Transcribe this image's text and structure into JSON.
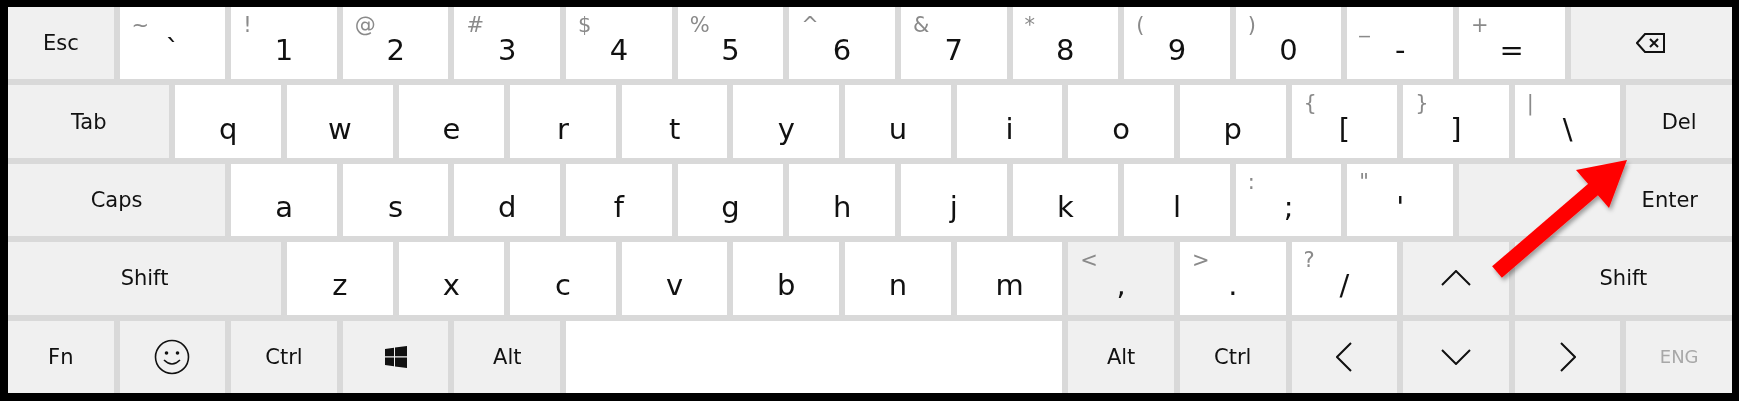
{
  "keyboard": {
    "rows": [
      {
        "keys": [
          {
            "kind": "function",
            "label": "Esc",
            "highlighted": false
          },
          {
            "kind": "char",
            "label": "`",
            "shift": "~",
            "highlighted": false
          },
          {
            "kind": "char",
            "label": "1",
            "shift": "!",
            "highlighted": false
          },
          {
            "kind": "char",
            "label": "2",
            "shift": "@",
            "highlighted": false
          },
          {
            "kind": "char",
            "label": "3",
            "shift": "#",
            "highlighted": false
          },
          {
            "kind": "char",
            "label": "4",
            "shift": "$",
            "highlighted": false
          },
          {
            "kind": "char",
            "label": "5",
            "shift": "%",
            "highlighted": false
          },
          {
            "kind": "char",
            "label": "6",
            "shift": "^",
            "highlighted": false
          },
          {
            "kind": "char",
            "label": "7",
            "shift": "&",
            "highlighted": false
          },
          {
            "kind": "char",
            "label": "8",
            "shift": "*",
            "highlighted": false
          },
          {
            "kind": "char",
            "label": "9",
            "shift": "(",
            "highlighted": false
          },
          {
            "kind": "char",
            "label": "0",
            "shift": ")",
            "highlighted": false
          },
          {
            "kind": "char",
            "label": "-",
            "shift": "_",
            "highlighted": false
          },
          {
            "kind": "char",
            "label": "=",
            "shift": "+",
            "highlighted": false
          },
          {
            "kind": "backspace",
            "highlighted": false
          }
        ]
      },
      {
        "keys": [
          {
            "kind": "function",
            "label": "Tab",
            "highlighted": false
          },
          {
            "kind": "char",
            "label": "q",
            "highlighted": false
          },
          {
            "kind": "char",
            "label": "w",
            "highlighted": false
          },
          {
            "kind": "char",
            "label": "e",
            "highlighted": false
          },
          {
            "kind": "char",
            "label": "r",
            "highlighted": false
          },
          {
            "kind": "char",
            "label": "t",
            "highlighted": false
          },
          {
            "kind": "char",
            "label": "y",
            "highlighted": false
          },
          {
            "kind": "char",
            "label": "u",
            "highlighted": false
          },
          {
            "kind": "char",
            "label": "i",
            "highlighted": false
          },
          {
            "kind": "char",
            "label": "o",
            "highlighted": false
          },
          {
            "kind": "char",
            "label": "p",
            "highlighted": false
          },
          {
            "kind": "char",
            "label": "[",
            "shift": "{",
            "highlighted": false
          },
          {
            "kind": "char",
            "label": "]",
            "shift": "}",
            "highlighted": false
          },
          {
            "kind": "char",
            "label": "\\",
            "shift": "|",
            "highlighted": false
          },
          {
            "kind": "function",
            "label": "Del",
            "highlighted": false
          }
        ]
      },
      {
        "keys": [
          {
            "kind": "function",
            "label": "Caps",
            "highlighted": false
          },
          {
            "kind": "char",
            "label": "a",
            "highlighted": false
          },
          {
            "kind": "char",
            "label": "s",
            "highlighted": false
          },
          {
            "kind": "char",
            "label": "d",
            "highlighted": false
          },
          {
            "kind": "char",
            "label": "f",
            "highlighted": false
          },
          {
            "kind": "char",
            "label": "g",
            "highlighted": false
          },
          {
            "kind": "char",
            "label": "h",
            "highlighted": false
          },
          {
            "kind": "char",
            "label": "j",
            "highlighted": false
          },
          {
            "kind": "char",
            "label": "k",
            "highlighted": false
          },
          {
            "kind": "char",
            "label": "l",
            "highlighted": false
          },
          {
            "kind": "char",
            "label": ";",
            "shift": ":",
            "highlighted": false
          },
          {
            "kind": "char",
            "label": "'",
            "shift": "\"",
            "highlighted": false
          },
          {
            "kind": "function",
            "label": "Enter",
            "highlighted": false
          }
        ]
      },
      {
        "keys": [
          {
            "kind": "function",
            "label": "Shift",
            "highlighted": false
          },
          {
            "kind": "char",
            "label": "z",
            "highlighted": false
          },
          {
            "kind": "char",
            "label": "x",
            "highlighted": false
          },
          {
            "kind": "char",
            "label": "c",
            "highlighted": false
          },
          {
            "kind": "char",
            "label": "v",
            "highlighted": false
          },
          {
            "kind": "char",
            "label": "b",
            "highlighted": false
          },
          {
            "kind": "char",
            "label": "n",
            "highlighted": false
          },
          {
            "kind": "char",
            "label": "m",
            "highlighted": false
          },
          {
            "kind": "char",
            "label": ",",
            "shift": "<",
            "highlighted": true
          },
          {
            "kind": "char",
            "label": ".",
            "shift": ">",
            "highlighted": false
          },
          {
            "kind": "char",
            "label": "/",
            "shift": "?",
            "highlighted": false
          },
          {
            "kind": "up",
            "highlighted": false
          },
          {
            "kind": "function",
            "label": "Shift",
            "highlighted": false
          }
        ]
      },
      {
        "keys": [
          {
            "kind": "function",
            "label": "Fn",
            "highlighted": false
          },
          {
            "kind": "emoji",
            "highlighted": false
          },
          {
            "kind": "function",
            "label": "Ctrl",
            "highlighted": false
          },
          {
            "kind": "windows",
            "highlighted": false
          },
          {
            "kind": "function",
            "label": "Alt",
            "highlighted": false
          },
          {
            "kind": "space",
            "highlighted": false
          },
          {
            "kind": "function",
            "label": "Alt",
            "highlighted": false
          },
          {
            "kind": "function",
            "label": "Ctrl",
            "highlighted": false
          },
          {
            "kind": "left",
            "highlighted": false
          },
          {
            "kind": "down",
            "highlighted": false
          },
          {
            "kind": "right",
            "highlighted": false
          },
          {
            "kind": "indicator",
            "label": "ENG",
            "highlighted": false
          }
        ]
      }
    ]
  },
  "pointer_arrow": true
}
